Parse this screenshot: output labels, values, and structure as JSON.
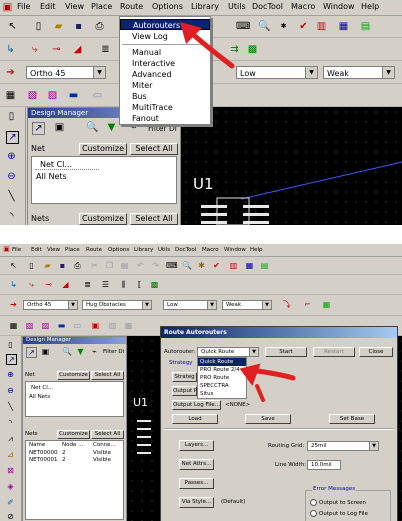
{
  "top": {
    "menu": [
      "File",
      "Edit",
      "View",
      "Place",
      "Route",
      "Options",
      "Library",
      "Utils",
      "DocTool",
      "Macro",
      "Window",
      "Help"
    ],
    "route_menu": {
      "items": [
        "Autorouters",
        "View Log",
        "Manual",
        "Interactive",
        "Advanced",
        "Miter",
        "Bus",
        "MultiTrace",
        "Fanout"
      ],
      "highlighted": "Autorouters"
    },
    "toolbar3": {
      "angle": "Ortho 45",
      "combo_low": "Low",
      "combo_weak": "Weak"
    },
    "design_manager": {
      "title": "Design Manager",
      "filter_label": "Filter Di",
      "net_label": "Net",
      "customize": "Customize",
      "select_all": "Select All",
      "tree": [
        "Net Cl...",
        "All Nets"
      ],
      "nets_label": "Nets"
    },
    "canvas": {
      "refdes": "U1"
    }
  },
  "bottom": {
    "menu": [
      "File",
      "Edit",
      "View",
      "Place",
      "Route",
      "Options",
      "Library",
      "Utils",
      "DocTool",
      "Macro",
      "Window",
      "Help"
    ],
    "toolbar3": {
      "angle": "Ortho 45",
      "obstacles": "Hug Obstacles",
      "combo_low": "Low",
      "combo_weak": "Weak"
    },
    "design_manager": {
      "title": "Design Manager",
      "filter_label": "Filter Di",
      "net_label": "Net",
      "customize": "Customize",
      "select_all": "Select All",
      "tree": [
        "Net Cl...",
        "All Nets"
      ],
      "nets_label": "Nets",
      "columns": [
        "Name",
        "Node ...",
        "Conne..."
      ],
      "rows": [
        [
          "NET00000",
          "2",
          "Visible"
        ],
        [
          "NET00001",
          "2",
          "Visible"
        ]
      ]
    },
    "canvas": {
      "refdes": "U1"
    },
    "dialog": {
      "title": "Route Autorouters",
      "autorouter_label": "Autorouter:",
      "autorouter_value": "Quick Route",
      "start": "Start",
      "restart": "Restart",
      "close": "Close",
      "strategy": "Strategy",
      "strategy_btn": "Strateg",
      "output_btn": "Output Pa",
      "output_log_btn": "Output Log File...",
      "none_label": "<NONE>",
      "load": "Load",
      "save": "Save",
      "set_base": "Set Base",
      "options": [
        "Quick Route",
        "PRO Route 2/4",
        "PRO Route",
        "SPECCTRA",
        "Situs"
      ],
      "layers": "Layers...",
      "net_attrs": "Net Attrs...",
      "passes": "Passes...",
      "via_style": "Via Style...",
      "via_default": "(Default)",
      "routing_grid_label": "Routing Grid:",
      "routing_grid_value": "25mil",
      "line_width_label": "Line Width:",
      "line_width_value": "10.0mil",
      "error_messages": "Error Messages",
      "output_screen": "Output to Screen",
      "output_log": "Output to Log File"
    }
  }
}
